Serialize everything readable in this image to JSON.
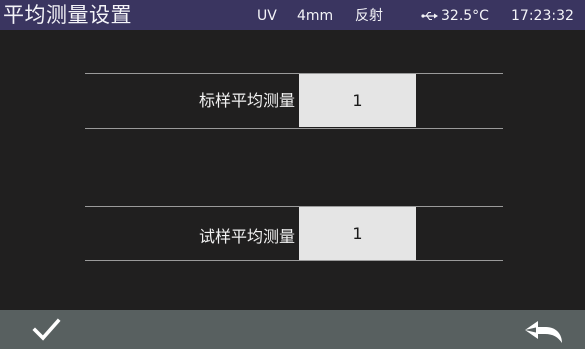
{
  "header": {
    "title": "平均测量设置",
    "light_source": "UV",
    "aperture": "4mm",
    "mode": "反射",
    "usb_icon": "usb-icon",
    "temperature": "32.5°C",
    "time": "17:23:32"
  },
  "settings": {
    "standard_avg": {
      "label": "标样平均测量",
      "value": "1"
    },
    "sample_avg": {
      "label": "试样平均测量",
      "value": "1"
    }
  },
  "footer": {
    "confirm_icon": "checkmark-icon",
    "back_icon": "back-arrow-icon"
  },
  "colors": {
    "header_bg": "#3a3560",
    "panel_bg": "#201f1f",
    "footer_bg": "#586060",
    "value_box_bg": "#e5e5e5"
  }
}
